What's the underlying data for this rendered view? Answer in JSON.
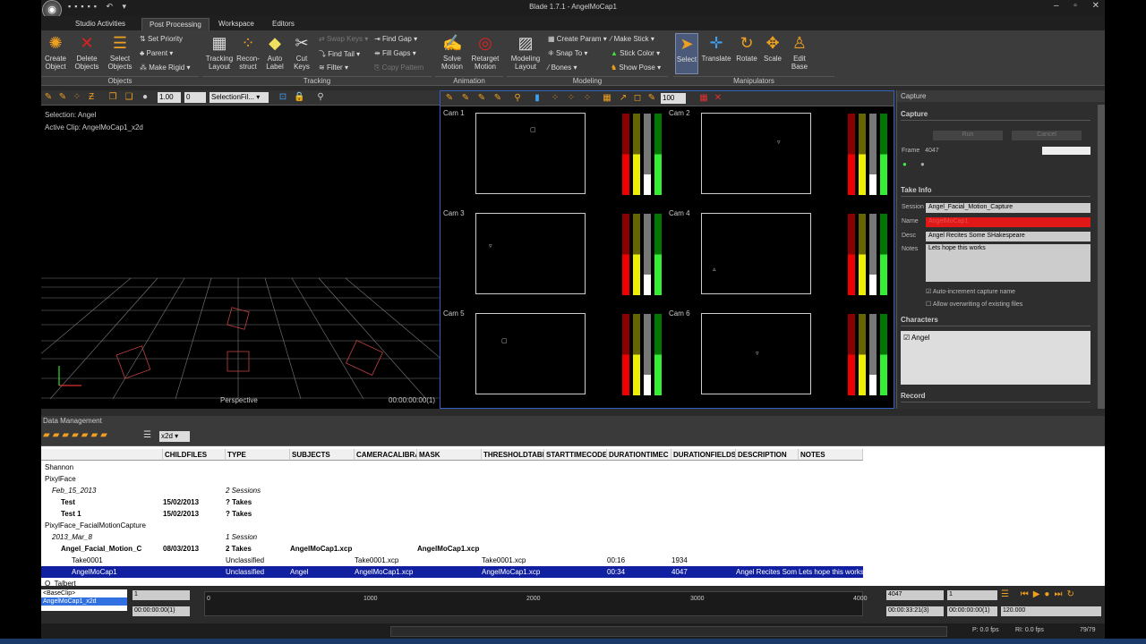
{
  "window": {
    "title": "Blade 1.7.1 - AngelMoCap1"
  },
  "tabs": [
    "Studio Activities",
    "Post Processing",
    "Workspace",
    "Editors"
  ],
  "ribbon": {
    "objects": {
      "create": "Create\nObject",
      "delete": "Delete\nObjects",
      "select": "Select\nObjects",
      "set_priority": "Set Priority",
      "parent": "Parent",
      "make_rigid": "Make Rigid",
      "group": "Objects"
    },
    "tracking": {
      "tracking_layout": "Tracking\nLayout",
      "reconstruct": "Recon-\nstruct",
      "auto_label": "Auto\nLabel",
      "cut_keys": "Cut\nKeys",
      "swap_keys": "Swap Keys",
      "find_tail": "Find Tail",
      "filter": "Filter",
      "find_gap": "Find Gap",
      "fill_gaps": "Fill Gaps",
      "copy_pattern": "Copy Pattern",
      "group": "Tracking"
    },
    "animation": {
      "solve_motion": "Solve\nMotion",
      "retarget_motion": "Retarget\nMotion",
      "group": "Animation"
    },
    "modeling": {
      "modeling_layout": "Modeling\nLayout",
      "create_param": "Create Param",
      "snap_to": "Snap To",
      "bones": "Bones",
      "make_stick": "Make Stick",
      "stick_color": "Stick Color",
      "show_pose": "Show Pose",
      "group": "Modeling"
    },
    "manipulators": {
      "select": "Select",
      "translate": "Translate",
      "rotate": "Rotate",
      "scale": "Scale",
      "edit_base": "Edit\nBase",
      "group": "Manipulators"
    }
  },
  "viewport": {
    "num1": "1.00",
    "num2": "0",
    "selection_filter": "SelectionFil...",
    "selection": "Selection: Angel",
    "active_clip": "Active Clip: AngelMoCap1_x2d",
    "label": "Perspective",
    "time": "00:00:00:00(1)"
  },
  "camview": {
    "zoom": "100",
    "cams": [
      "Cam 1",
      "Cam 2",
      "Cam 3",
      "Cam 4",
      "Cam 5",
      "Cam 6"
    ]
  },
  "capture": {
    "panel_title": "Capture",
    "header": "Capture",
    "run": "Run",
    "cancel": "Cancel",
    "frame_label": "Frame",
    "frame_value": "4047",
    "take_info": "Take Info",
    "session_label": "Session",
    "session": "Angel_Facial_Motion_Capture",
    "name_label": "Name",
    "name": "AngelMoCap1",
    "desc_label": "Desc",
    "desc": "Angel Recites Some SHakespeare",
    "notes_label": "Notes",
    "notes": "Lets hope this works",
    "auto_increment": "Auto-increment capture name",
    "allow_overwrite": "Allow overwriting of existing files",
    "characters": "Characters",
    "character1": "Angel",
    "record": "Record"
  },
  "data_management": {
    "title": "Data Management",
    "filter": "x2d",
    "columns": [
      "CHILDFILES",
      "TYPE",
      "SUBJECTS",
      "CAMERACALIBRA",
      "MASK",
      "THRESHOLDTABL",
      "STARTTIMECODE",
      "DURATIONTIMEC",
      "DURATIONFIELDS",
      "DESCRIPTION",
      "NOTES"
    ],
    "rows": [
      {
        "name": "Shannon",
        "c1": "",
        "c2": "",
        "c3": "",
        "c4": "",
        "c5": "",
        "c6": "",
        "c8": "",
        "c9": "",
        "c10": "",
        "c11": ""
      },
      {
        "name": "PixylFace",
        "c1": "",
        "c2": "",
        "c3": "",
        "c4": "",
        "c5": "",
        "c6": "",
        "c8": "",
        "c9": "",
        "c10": "",
        "c11": ""
      },
      {
        "name": "Feb_15_2013",
        "c1": "",
        "c2": "2 Sessions",
        "c3": "",
        "c4": "",
        "c5": "",
        "c6": "",
        "c8": "",
        "c9": "",
        "c10": "",
        "c11": ""
      },
      {
        "name": "Test",
        "c1": "15/02/2013",
        "c2": "? Takes",
        "c3": "",
        "c4": "",
        "c5": "",
        "c6": "",
        "c8": "",
        "c9": "",
        "c10": "",
        "c11": ""
      },
      {
        "name": "Test 1",
        "c1": "15/02/2013",
        "c2": "? Takes",
        "c3": "",
        "c4": "",
        "c5": "",
        "c6": "",
        "c8": "",
        "c9": "",
        "c10": "",
        "c11": ""
      },
      {
        "name": "PixylFace_FacialMotionCapture",
        "c1": "",
        "c2": "",
        "c3": "",
        "c4": "",
        "c5": "",
        "c6": "",
        "c8": "",
        "c9": "",
        "c10": "",
        "c11": ""
      },
      {
        "name": "2013_Mar_8",
        "c1": "",
        "c2": "1 Session",
        "c3": "",
        "c4": "",
        "c5": "",
        "c6": "",
        "c8": "",
        "c9": "",
        "c10": "",
        "c11": ""
      },
      {
        "name": "Angel_Facial_Motion_C",
        "c1": "08/03/2013",
        "c2": "2 Takes",
        "c3": "AngelMoCap1.xcp",
        "c4": "",
        "c5": "AngelMoCap1.xcp",
        "c6": "",
        "c8": "",
        "c9": "",
        "c10": "",
        "c11": ""
      },
      {
        "name": "Take0001",
        "c1": "",
        "c2": "Unclassified",
        "c3": "",
        "c4": "Take0001.xcp",
        "c5": "",
        "c6": "Take0001.xcp",
        "c8": "00:16",
        "c9": "1934",
        "c10": "",
        "c11": ""
      },
      {
        "name": "AngelMoCap1",
        "c1": "",
        "c2": "Unclassified",
        "c3": "Angel",
        "c4": "AngelMoCap1.xcp",
        "c5": "",
        "c6": "AngelMoCap1.xcp",
        "c8": "00:34",
        "c9": "4047",
        "c10": "Angel Recites Som",
        "c11": "Lets hope this works"
      },
      {
        "name": "O_Talbert",
        "c1": "",
        "c2": "",
        "c3": "",
        "c4": "",
        "c5": "",
        "c6": "",
        "c8": "",
        "c9": "",
        "c10": "",
        "c11": ""
      }
    ]
  },
  "timeline": {
    "clip1": "<BaseClip>",
    "clip2": "AngelMoCap1_x2d",
    "start": "1",
    "start_tc": "00:00:00:00(1)",
    "marks": [
      "0",
      "1000",
      "2000",
      "3000",
      "4000"
    ],
    "end": "4047",
    "cur": "1",
    "end_tc": "00:00:33:21(3)",
    "cur_tc": "00:00:00:00(1)",
    "fps": "120.000"
  },
  "status": {
    "play": "P: 0.0 fps",
    "rt": "RI: 0.0 fps",
    "frames": "79/79"
  }
}
